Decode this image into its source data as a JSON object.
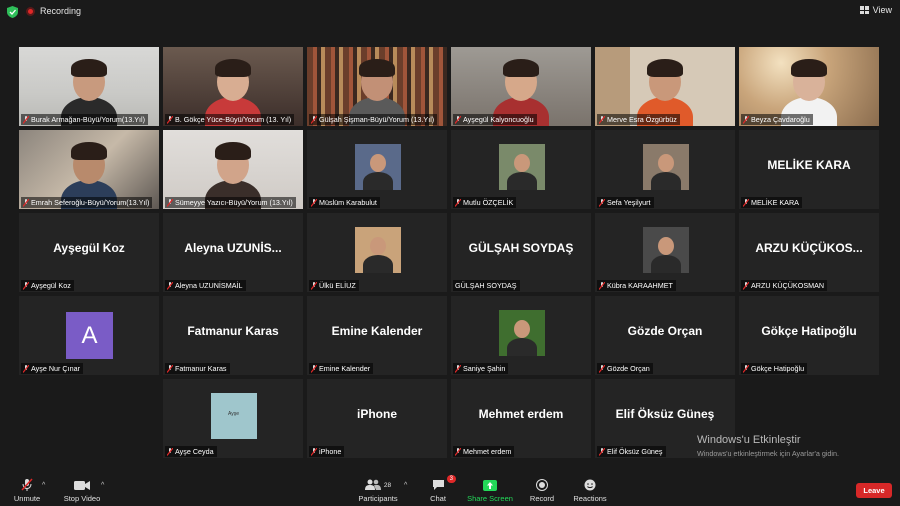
{
  "topbar": {
    "recording_label": "Recording",
    "view_label": "View"
  },
  "participants": [
    {
      "label": "Burak Armağan-Büyü/Yorum(13.Yıl)",
      "kind": "video"
    },
    {
      "label": "B. Gökçe Yüce-Büyü/Yorum (13. Yıl)",
      "kind": "video"
    },
    {
      "label": "Gülşah Şişman-Büyü/Yorum (13.Yıl)",
      "kind": "video"
    },
    {
      "label": "Ayşegül Kalyoncuoğlu",
      "kind": "video"
    },
    {
      "label": "Merve Esra Özgürbüz",
      "kind": "video",
      "active": true
    },
    {
      "label": "Beyza Çavdaroğlu",
      "kind": "video"
    },
    {
      "label": "Emrah Seferoğlu-Büyü/Yorum(13.Yıl)",
      "kind": "video"
    },
    {
      "label": "Sümeyye Yazıcı-Büyü/Yorum (13.Yıl)",
      "kind": "video"
    },
    {
      "label": "Müslüm Karabulut",
      "kind": "photo"
    },
    {
      "label": "Mutlu ÖZÇELİK",
      "kind": "photo"
    },
    {
      "label": "Sefa Yeşilyurt",
      "kind": "photo"
    },
    {
      "label": "MELİKE KARA",
      "kind": "name",
      "display": "MELİKE KARA"
    },
    {
      "label": "Ayşegül Koz",
      "kind": "name",
      "display": "Ayşegül Koz"
    },
    {
      "label": "Aleyna UZUNİSMAİL",
      "kind": "name",
      "display": "Aleyna  UZUNİS..."
    },
    {
      "label": "Ülkü ELİUZ",
      "kind": "photo"
    },
    {
      "label": "GÜLŞAH SOYDAŞ",
      "kind": "name",
      "display": "GÜLŞAH SOYDAŞ",
      "no_mic": true
    },
    {
      "label": "Kübra KARAAHMET",
      "kind": "photo"
    },
    {
      "label": "ARZU KÜÇÜKOSMAN",
      "kind": "name",
      "display": "ARZU  KÜÇÜKOS..."
    },
    {
      "label": "Ayşe Nur Çınar",
      "kind": "avatar",
      "initial": "A"
    },
    {
      "label": "Fatmanur Karas",
      "kind": "name",
      "display": "Fatmanur Karas"
    },
    {
      "label": "Emine Kalender",
      "kind": "name",
      "display": "Emine Kalender"
    },
    {
      "label": "Saniye Şahin",
      "kind": "photo"
    },
    {
      "label": "Gözde Orçan",
      "kind": "name",
      "display": "Gözde Orçan"
    },
    {
      "label": "Gökçe Hatipoğlu",
      "kind": "name",
      "display": "Gökçe Hatipoğlu"
    },
    {
      "label": "Ayşe Ceyda",
      "kind": "photo",
      "photo_text": "Ayşe"
    },
    {
      "label": "iPhone",
      "kind": "name",
      "display": "iPhone"
    },
    {
      "label": "Mehmet erdem",
      "kind": "name",
      "display": "Mehmet erdem"
    },
    {
      "label": "Elif Öksüz Güneş",
      "kind": "name",
      "display": "Elif Öksüz Güneş"
    }
  ],
  "watermark": {
    "title": "Windows'u Etkinleştir",
    "subtitle": "Windows'u etkinleştirmek için Ayarlar'a gidin."
  },
  "toolbar": {
    "unmute": "Unmute",
    "stop_video": "Stop Video",
    "participants": "Participants",
    "participants_count": "28",
    "chat": "Chat",
    "chat_badge": "3",
    "share_screen": "Share Screen",
    "record": "Record",
    "reactions": "Reactions",
    "leave": "Leave"
  },
  "colors": {
    "share_green": "#23d959",
    "leave_red": "#d72828",
    "active_outline": "#e8e85a",
    "avatar_purple": "#7a5cc6"
  }
}
